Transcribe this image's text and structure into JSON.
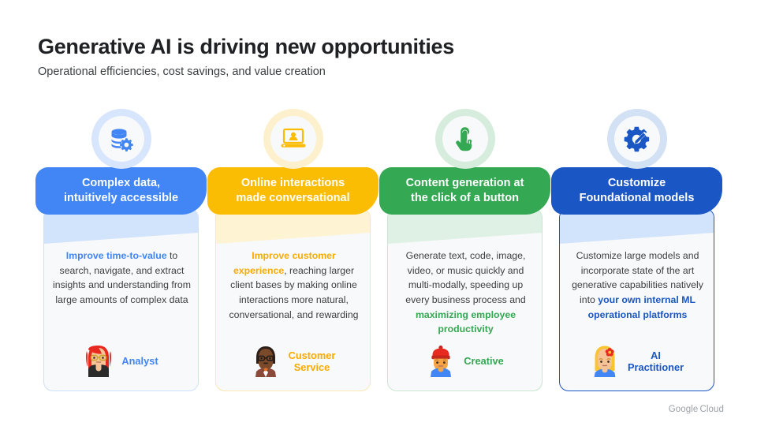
{
  "slide": {
    "title": "Generative AI is driving new opportunities",
    "subtitle": "Operational efficiencies, cost savings, and value creation",
    "footer_logo": {
      "word1": "Google",
      "word2": "Cloud"
    },
    "background": "#ffffff"
  },
  "cards": [
    {
      "id": "complex-data",
      "icon": "database-gear-icon",
      "header": {
        "line1": "Complex data,",
        "line2": "intuitively accessible"
      },
      "body_segments": [
        {
          "text": "Improve time-to-value",
          "bold": true
        },
        {
          "text": " to search, navigate, and extract insights and understanding from large amounts of complex data",
          "bold": false
        }
      ],
      "persona": {
        "name_line1": "Analyst",
        "name_line2": "",
        "avatar": "woman-red-hair-glasses-avatar"
      },
      "colors": {
        "accent": "#4285f4",
        "header_bg": "#4285f4",
        "ring": "#d7e5fd",
        "band": "#d2e3fc",
        "text_accent": "#4285f4",
        "body_border": "#cfe0fb"
      }
    },
    {
      "id": "online-interactions",
      "icon": "laptop-person-icon",
      "header": {
        "line1": "Online interactions",
        "line2": "made conversational"
      },
      "body_segments": [
        {
          "text": "Improve customer experience",
          "bold": true
        },
        {
          "text": ", reaching larger client bases by making online interactions more natural, conversational, and rewarding",
          "bold": false
        }
      ],
      "persona": {
        "name_line1": "Customer",
        "name_line2": "Service",
        "avatar": "man-dark-skin-glasses-avatar"
      },
      "colors": {
        "accent": "#fbbc04",
        "header_bg": "#fbbc04",
        "ring": "#fdf0cd",
        "band": "#fef3d3",
        "text_accent": "#f9ab00",
        "body_border": "#fbe7b4"
      }
    },
    {
      "id": "content-generation",
      "icon": "tap-hand-icon",
      "header": {
        "line1": "Content generation at",
        "line2": "the click of a button"
      },
      "body_segments": [
        {
          "text": "Generate text, code, image, video, or music quickly and multi-modally, speeding up every business process and ",
          "bold": false
        },
        {
          "text": "maximizing employee productivity",
          "bold": true
        }
      ],
      "persona": {
        "name_line1": "Creative",
        "name_line2": "",
        "avatar": "person-red-beanie-avatar"
      },
      "colors": {
        "accent": "#34a853",
        "header_bg": "#34a853",
        "ring": "#d6ecdd",
        "band": "#dff0e4",
        "text_accent": "#34a853",
        "body_border": "#c8e6d2"
      }
    },
    {
      "id": "customize-foundational-models",
      "icon": "gear-pencil-icon",
      "header": {
        "line1": "Customize",
        "line2": "Foundational models"
      },
      "body_segments": [
        {
          "text": "Customize large models and incorporate state of the art generative capabilities natively into ",
          "bold": false
        },
        {
          "text": "your own internal ML operational platforms",
          "bold": true
        }
      ],
      "persona": {
        "name_line1": "AI",
        "name_line2": "Practitioner",
        "avatar": "woman-blonde-flower-avatar"
      },
      "colors": {
        "accent": "#1a56c4",
        "header_bg": "#1a56c4",
        "ring": "#d3e1f5",
        "band": "#d2e3fc",
        "text_accent": "#1a56c4",
        "body_border": "#1a56c4"
      }
    }
  ]
}
